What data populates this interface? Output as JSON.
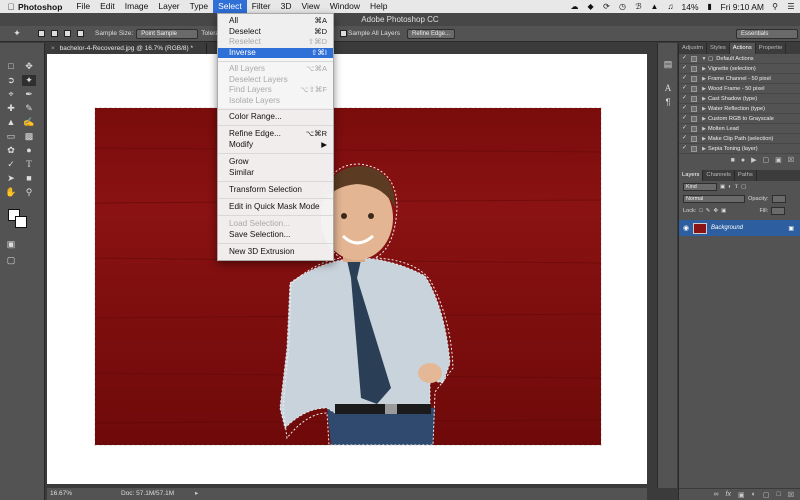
{
  "menubar": {
    "app_name": "Photoshop",
    "items": [
      "File",
      "Edit",
      "Image",
      "Layer",
      "Type",
      "Select",
      "Filter",
      "3D",
      "View",
      "Window",
      "Help"
    ],
    "battery": "14%",
    "clock": "Fri 9:10 AM"
  },
  "window": {
    "title": "Adobe Photoshop CC"
  },
  "options_bar": {
    "sample_size_label": "Sample Size:",
    "sample_size_value": "Point Sample",
    "tolerance_label": "Tolera",
    "sample_all_layers": "Sample All Layers",
    "refine_edge": "Refine Edge...",
    "workspace": "Essentials"
  },
  "document": {
    "tab_title": "bachelor-4-Recovered.jpg @ 16.7% (RGB/8) *",
    "zoom": "16.67%",
    "doc_info": "Doc: 57.1M/57.1M"
  },
  "select_menu": {
    "items": [
      {
        "label": "All",
        "shortcut": "⌘A",
        "disabled": false
      },
      {
        "label": "Deselect",
        "shortcut": "⌘D",
        "disabled": false
      },
      {
        "label": "Reselect",
        "shortcut": "⇧⌘D",
        "disabled": true
      },
      {
        "label": "Inverse",
        "shortcut": "⇧⌘I",
        "disabled": false
      },
      {
        "label": "All Layers",
        "shortcut": "⌥⌘A",
        "disabled": true
      },
      {
        "label": "Deselect Layers",
        "shortcut": "",
        "disabled": true
      },
      {
        "label": "Find Layers",
        "shortcut": "⌥⇧⌘F",
        "disabled": true
      },
      {
        "label": "Isolate Layers",
        "shortcut": "",
        "disabled": true
      },
      {
        "label": "Color Range...",
        "shortcut": "",
        "disabled": false
      },
      {
        "label": "Refine Edge...",
        "shortcut": "⌥⌘R",
        "disabled": false
      },
      {
        "label": "Modify",
        "shortcut": "▶",
        "disabled": false
      },
      {
        "label": "Grow",
        "shortcut": "",
        "disabled": false
      },
      {
        "label": "Similar",
        "shortcut": "",
        "disabled": false
      },
      {
        "label": "Transform Selection",
        "shortcut": "",
        "disabled": false
      },
      {
        "label": "Edit in Quick Mask Mode",
        "shortcut": "",
        "disabled": false
      },
      {
        "label": "Load Selection...",
        "shortcut": "",
        "disabled": true
      },
      {
        "label": "Save Selection...",
        "shortcut": "",
        "disabled": false
      },
      {
        "label": "New 3D Extrusion",
        "shortcut": "",
        "disabled": false
      }
    ]
  },
  "actions_panel": {
    "tabs": [
      "Adjustm",
      "Styles",
      "Actions",
      "Propertie"
    ],
    "group": "Default Actions",
    "items": [
      "Vignette (selection)",
      "Frame Channel - 50 pixel",
      "Wood Frame - 50 pixel",
      "Cast Shadow (type)",
      "Water Reflection (type)",
      "Custom RGB to Grayscale",
      "Molten Lead",
      "Make Clip Path (selection)",
      "Sepia Toning (layer)"
    ]
  },
  "layers_panel": {
    "tabs": [
      "Layers",
      "Channels",
      "Paths"
    ],
    "kind": "Kind",
    "blend_mode": "Normal",
    "opacity_label": "Opacity:",
    "lock_label": "Lock:",
    "fill_label": "Fill:",
    "layer_name": "Background"
  }
}
